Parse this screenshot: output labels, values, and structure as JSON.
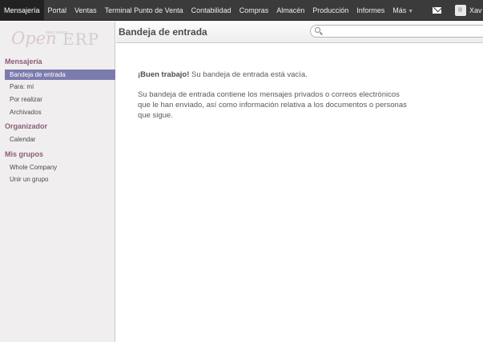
{
  "topbar": {
    "menu": [
      "Mensajería",
      "Portal",
      "Ventas",
      "Terminal Punto de Venta",
      "Contabilidad",
      "Compras",
      "Almacén",
      "Producción",
      "Informes",
      "Más"
    ],
    "user": "Xav"
  },
  "logo": {
    "open": "Open",
    "erp": "ERP",
    "tagline": "open source"
  },
  "sidebar": {
    "sections": [
      {
        "title": "Mensajería",
        "items": [
          "Bandeja de entrada",
          "Para: mí",
          "Por realizar",
          "Archivados"
        ]
      },
      {
        "title": "Organizador",
        "items": [
          "Calendar"
        ]
      },
      {
        "title": "Mis grupos",
        "items": [
          "Whole Company",
          "Unir un grupo"
        ]
      }
    ],
    "active_item": "Bandeja de entrada"
  },
  "header": {
    "title": "Bandeja de entrada",
    "search_value": ""
  },
  "content": {
    "heading_bold": "¡Buen trabajo!",
    "heading_rest": " Su bandeja de entrada está vacía.",
    "body_lines": [
      "Su bandeja de entrada contiene los mensajes privados o correos electrónicos",
      "que le han enviado, así como información relativa a los documentos o personas",
      "que sigue."
    ]
  }
}
